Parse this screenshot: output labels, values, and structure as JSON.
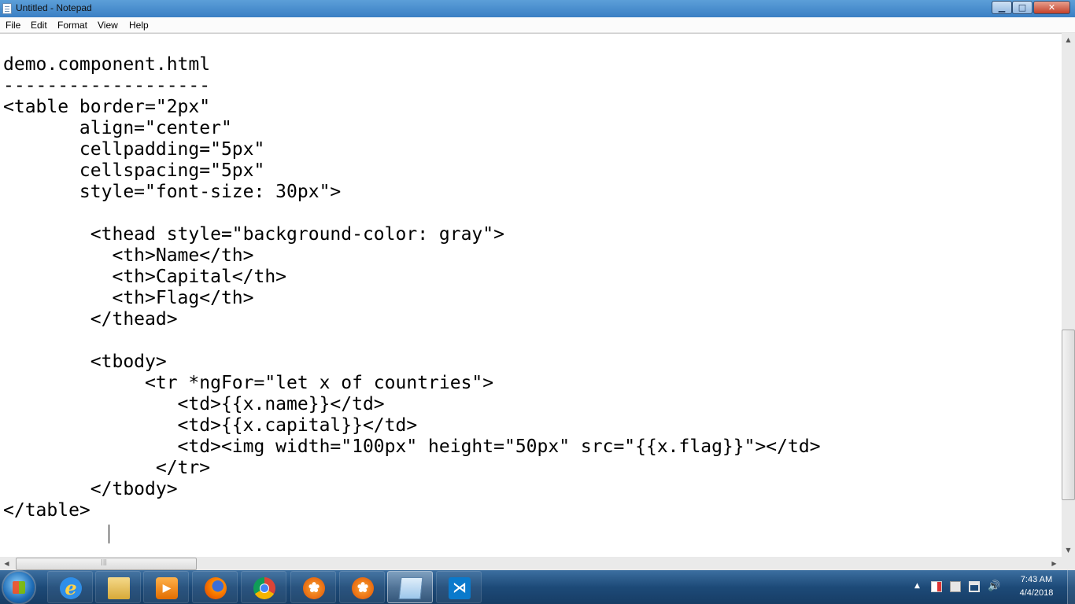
{
  "window": {
    "title": "Untitled - Notepad"
  },
  "menu": {
    "items": [
      "File",
      "Edit",
      "Format",
      "View",
      "Help"
    ]
  },
  "editor": {
    "content": "demo.component.html\n-------------------\n<table border=\"2px\"\n       align=\"center\"\n       cellpadding=\"5px\"\n       cellspacing=\"5px\"\n       style=\"font-size: 30px\">\n\n        <thead style=\"background-color: gray\">\n          <th>Name</th>\n          <th>Capital</th>\n          <th>Flag</th>\n        </thead>\n\n        <tbody>\n             <tr *ngFor=\"let x of countries\">\n                <td>{{x.name}}</td>\n                <td>{{x.capital}}</td>\n                <td><img width=\"100px\" height=\"50px\" src=\"{{x.flag}}\"></td>\n              </tr>\n        </tbody>\n</table>"
  },
  "taskbar": {
    "apps": [
      {
        "icon": "internet-explorer-icon"
      },
      {
        "icon": "file-explorer-icon"
      },
      {
        "icon": "media-player-icon"
      },
      {
        "icon": "firefox-icon"
      },
      {
        "icon": "chrome-icon"
      },
      {
        "icon": "flower-app-icon"
      },
      {
        "icon": "flower-app-icon"
      },
      {
        "icon": "notepad-icon",
        "active": true
      },
      {
        "icon": "vscode-icon"
      }
    ],
    "clock": {
      "time": "7:43 AM",
      "date": "4/4/2018"
    }
  },
  "colors": {
    "titlebar": "#3a7fc4",
    "taskbar": "#1d4a78",
    "close": "#c3412a"
  }
}
